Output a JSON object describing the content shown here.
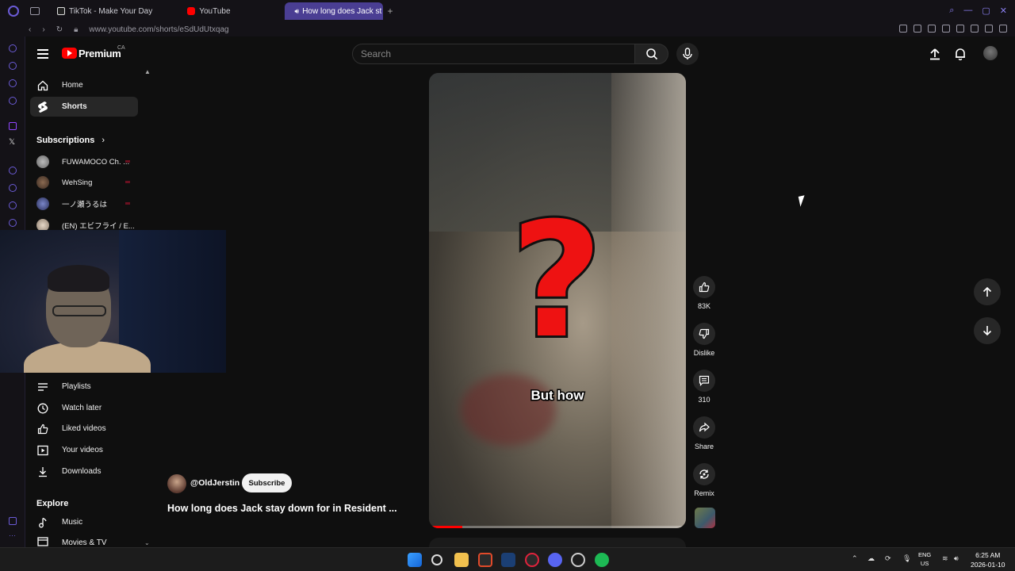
{
  "browser": {
    "tabs": [
      {
        "label": "TikTok - Make Your Day",
        "active": false
      },
      {
        "label": "YouTube",
        "active": false
      },
      {
        "label": "How long does Jack st",
        "active": true
      }
    ],
    "url": "www.youtube.com/shorts/eSdUdUtxqag",
    "accent": "#6b5bd6"
  },
  "header": {
    "brand": "Premium",
    "country": "CA",
    "search_placeholder": "Search"
  },
  "sidebar": {
    "items": [
      {
        "label": "Home",
        "icon": "home-icon"
      },
      {
        "label": "Shorts",
        "icon": "shorts-icon",
        "active": true
      }
    ],
    "subscriptions_title": "Subscriptions",
    "subscriptions": [
      {
        "label": "FUWAMOCO Ch. ..."
      },
      {
        "label": "WehSing"
      },
      {
        "label": "一ノ瀬うるは"
      },
      {
        "label": "(EN) エビフライ / E..."
      }
    ],
    "you_items": [
      {
        "label": "Playlists",
        "icon": "playlist-icon"
      },
      {
        "label": "Watch later",
        "icon": "clock-icon"
      },
      {
        "label": "Liked videos",
        "icon": "thumbs-up-icon"
      },
      {
        "label": "Your videos",
        "icon": "video-icon"
      },
      {
        "label": "Downloads",
        "icon": "download-icon"
      }
    ],
    "explore_title": "Explore",
    "explore_items": [
      {
        "label": "Music",
        "icon": "music-icon"
      },
      {
        "label": "Movies & TV",
        "icon": "movie-icon"
      }
    ]
  },
  "short": {
    "caption": "But how",
    "overlay_symbol": "?",
    "channel": "@OldJerstin",
    "subscribe_label": "Subscribe",
    "title": "How long does Jack stay down for in Resident ...",
    "progress": 0.13
  },
  "actions": [
    {
      "label": "83K",
      "icon": "thumbs-up-icon"
    },
    {
      "label": "Dislike",
      "icon": "thumbs-down-icon"
    },
    {
      "label": "310",
      "icon": "comment-icon"
    },
    {
      "label": "Share",
      "icon": "share-icon"
    },
    {
      "label": "Remix",
      "icon": "remix-icon"
    }
  ],
  "taskbar": {
    "lang_line1": "ENG",
    "lang_line2": "US",
    "time": "6:25 AM",
    "date": "2026-01-10"
  },
  "colors": {
    "youtube_red": "#ff0000",
    "background": "#0f0f0f"
  }
}
